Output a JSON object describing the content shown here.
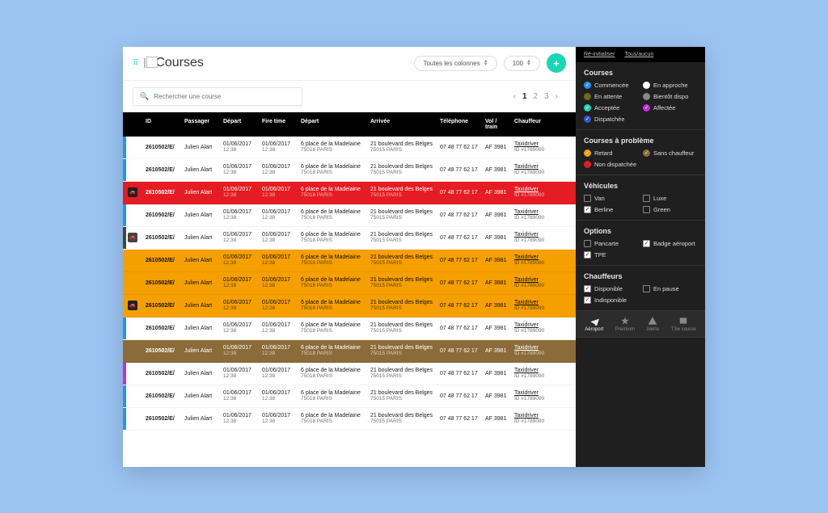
{
  "header": {
    "title": "Courses",
    "columns_selector": "Toutes les colonnes",
    "page_size": "100"
  },
  "search": {
    "placeholder": "Rechercher une course"
  },
  "pagination": {
    "prev": "‹",
    "pages": [
      "1",
      "2",
      "3"
    ],
    "next": "›",
    "current": 0
  },
  "columns": [
    "ID",
    "Passager",
    "Départ",
    "Fire time",
    "Départ",
    "Arrivée",
    "Téléphone",
    "Vol / train",
    "Chauffeur"
  ],
  "row": {
    "id": "2610502/E/",
    "passager": "Julien Alart",
    "depart_date": "01/06/2017",
    "depart_time": "12:38",
    "fire_date": "01/06/2017",
    "fire_time": "12:38",
    "depart_addr": "6 place de la Madelaine",
    "depart_city": "75018 PARIS",
    "arr_addr": "21 boulevard des Belges",
    "arr_city": "75015 PARIS",
    "tel": "07 48 77 62 17",
    "vol": "AF 3981",
    "driver": "Taxidriver",
    "driver_id": "ID #1789090"
  },
  "row_states": [
    "blue",
    "blue",
    "red",
    "blue",
    "gray",
    "orange",
    "orange",
    "orange",
    "blue",
    "brown",
    "pink",
    "blue",
    "blue"
  ],
  "row_icons": {
    "2": "+2",
    "4": "+10",
    "7": "+11"
  },
  "sidebar": {
    "top_links": [
      "Ré-initialiser",
      "Tous/aucun"
    ],
    "sections": {
      "courses": {
        "title": "Courses",
        "items": [
          {
            "label": "Commencée",
            "color": "#2196f3",
            "check": true
          },
          {
            "label": "En approche",
            "color": "#ffffff",
            "check": true
          },
          {
            "label": "En attente",
            "color": "#6b6b1a",
            "check": false
          },
          {
            "label": "Bientôt dispo",
            "color": "#888",
            "check": false
          },
          {
            "label": "Acceptée",
            "color": "#19d6b5",
            "check": true
          },
          {
            "label": "Affectée",
            "color": "#c22fd6",
            "check": true
          },
          {
            "label": "Dispatchée",
            "color": "#2a5ad0",
            "check": true
          }
        ]
      },
      "problemes": {
        "title": "Courses à problème",
        "items": [
          {
            "label": "Retard",
            "color": "#f59f00",
            "check": true
          },
          {
            "label": "Sans chauffeur",
            "color": "#8b6b3a",
            "check": true
          },
          {
            "label": "Non dispatchée",
            "color": "#e51c23",
            "check": false
          }
        ]
      },
      "vehicules": {
        "title": "Véhicules",
        "items": [
          {
            "label": "Van",
            "checked": false
          },
          {
            "label": "Luxe",
            "checked": false
          },
          {
            "label": "Berline",
            "checked": true
          },
          {
            "label": "Green",
            "checked": false
          }
        ]
      },
      "options": {
        "title": "Options",
        "items": [
          {
            "label": "Pancarte",
            "checked": false
          },
          {
            "label": "Badge aéroport",
            "checked": true
          },
          {
            "label": "TPE",
            "checked": true
          }
        ]
      },
      "chauffeurs": {
        "title": "Chauffeurs",
        "items": [
          {
            "label": "Disponible",
            "checked": true
          },
          {
            "label": "En pause",
            "checked": false
          },
          {
            "label": "Indisponible",
            "checked": true
          }
        ]
      }
    },
    "iconbar": [
      {
        "name": "Aéroport",
        "active": true
      },
      {
        "name": "Premium",
        "active": false
      },
      {
        "name": "Alerte",
        "active": false
      },
      {
        "name": "T3w course",
        "active": false
      }
    ]
  }
}
